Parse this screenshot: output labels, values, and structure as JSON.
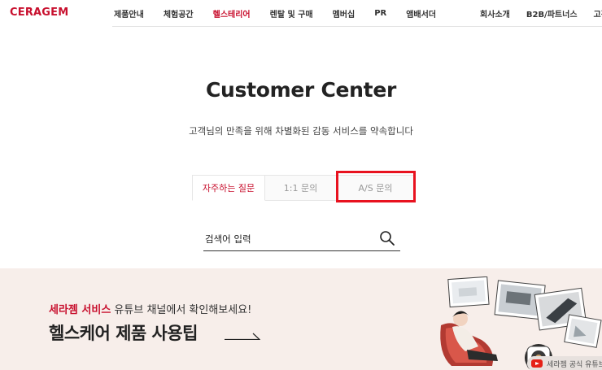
{
  "brand": {
    "logo": "CERAGEM",
    "accent": "#c8102e",
    "highlight": "#e8121f"
  },
  "nav": {
    "items": [
      {
        "label": "제품안내",
        "active": false
      },
      {
        "label": "체험공간",
        "active": false
      },
      {
        "label": "헬스테리어",
        "active": true
      },
      {
        "label": "렌탈 및 구매",
        "active": false
      },
      {
        "label": "멤버십",
        "active": false
      },
      {
        "label": "PR",
        "active": false
      },
      {
        "label": "앰배서더",
        "active": false
      }
    ],
    "secondary": [
      {
        "label": "회사소개"
      },
      {
        "label": "B2B/파트너스"
      },
      {
        "label": "고객센터"
      }
    ]
  },
  "hero": {
    "title": "Customer Center",
    "subtitle": "고객님의 만족을 위해 차별화된 감동 서비스를 약속합니다"
  },
  "tabs": [
    {
      "label": "자주하는 질문",
      "active": true
    },
    {
      "label": "1:1 문의",
      "active": false
    },
    {
      "label": "A/S 문의",
      "active": false
    }
  ],
  "search": {
    "placeholder": "검색어 입력",
    "value": ""
  },
  "banner": {
    "highlight": "세라젬 서비스",
    "line1_rest": " 유튜브 채널에서 확인해보세요!",
    "line2": "헬스케어 제품 사용팁",
    "background": "#f7eeea",
    "youtube_label": "세라젬 공식 유튜브"
  }
}
